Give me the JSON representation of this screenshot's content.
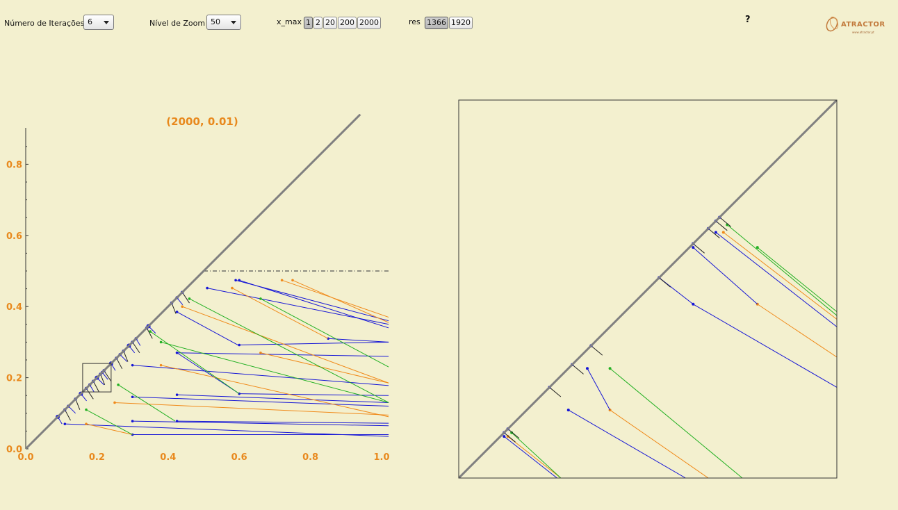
{
  "controls": {
    "iterations_label": "Número de Iterações",
    "iterations_value": "6",
    "zoom_label": "Nível de Zoom",
    "zoom_value": "50",
    "xmax_label": "x_max",
    "xmax_options": [
      "1",
      "2",
      "20",
      "200",
      "2000"
    ],
    "xmax_selected": "1",
    "res_label": "res",
    "res_options": [
      "1366",
      "1920"
    ],
    "res_selected": "1366",
    "help": "?"
  },
  "logo": {
    "name": "ATRACTOR",
    "url_text": "www.atractor.pt"
  },
  "colors": {
    "background": "#f3f0cf",
    "axis_text": "#e8891d",
    "diagonal": "#808080",
    "blue": "#1515d6",
    "orange": "#f08a1a",
    "green": "#22b022"
  },
  "chart_data": [
    {
      "type": "line",
      "title": "(2000, 0.01)",
      "x_ticks": [
        "0.0",
        "0.2",
        "0.4",
        "0.6",
        "0.8",
        "1.0"
      ],
      "y_ticks": [
        "0.0",
        "0.2",
        "0.4",
        "0.6",
        "0.8"
      ],
      "xlim": [
        0,
        1.02
      ],
      "ylim": [
        0,
        0.9
      ],
      "diagonal": [
        [
          0,
          0
        ],
        [
          0.94,
          0.94
        ]
      ],
      "dashed_line_y": 0.5,
      "dashed_line_x": [
        0.5,
        1.02
      ],
      "zoom_box": {
        "x": [
          0.16,
          0.24
        ],
        "y": [
          0.16,
          0.24
        ]
      },
      "diagonal_points": [
        0.09,
        0.11,
        0.12,
        0.14,
        0.155,
        0.17,
        0.18,
        0.19,
        0.2,
        0.21,
        0.215,
        0.22,
        0.24,
        0.255,
        0.265,
        0.275,
        0.29,
        0.3,
        0.31,
        0.34,
        0.345,
        0.41,
        0.425,
        0.44
      ],
      "segments": [
        {
          "c": "blue",
          "pts": [
            [
              0.11,
              0.07
            ],
            [
              1.02,
              0.035
            ]
          ]
        },
        {
          "c": "blue",
          "pts": [
            [
              0.3,
              0.04
            ],
            [
              1.02,
              0.04
            ]
          ]
        },
        {
          "c": "blue",
          "pts": [
            [
              0.3,
              0.078
            ],
            [
              1.02,
              0.065
            ]
          ]
        },
        {
          "c": "blue",
          "pts": [
            [
              0.425,
              0.078
            ],
            [
              1.02,
              0.072
            ]
          ]
        },
        {
          "c": "blue",
          "pts": [
            [
              0.3,
              0.146
            ],
            [
              1.02,
              0.12
            ]
          ]
        },
        {
          "c": "blue",
          "pts": [
            [
              0.425,
              0.152
            ],
            [
              1.02,
              0.13
            ]
          ]
        },
        {
          "c": "blue",
          "pts": [
            [
              0.6,
              0.155
            ],
            [
              1.02,
              0.15
            ]
          ]
        },
        {
          "c": "blue",
          "pts": [
            [
              0.3,
              0.235
            ],
            [
              1.02,
              0.178
            ]
          ]
        },
        {
          "c": "blue",
          "pts": [
            [
              0.425,
              0.27
            ],
            [
              1.02,
              0.26
            ]
          ]
        },
        {
          "c": "blue",
          "pts": [
            [
              0.6,
              0.292
            ],
            [
              1.02,
              0.3
            ]
          ]
        },
        {
          "c": "blue",
          "pts": [
            [
              0.85,
              0.31
            ],
            [
              1.02,
              0.3
            ]
          ]
        },
        {
          "c": "blue",
          "pts": [
            [
              0.51,
              0.452
            ],
            [
              1.02,
              0.35
            ]
          ]
        },
        {
          "c": "blue",
          "pts": [
            [
              0.59,
              0.474
            ],
            [
              1.02,
              0.36
            ]
          ]
        },
        {
          "c": "blue",
          "pts": [
            [
              0.6,
              0.474
            ],
            [
              1.02,
              0.34
            ]
          ]
        },
        {
          "c": "blue",
          "pts": [
            [
              0.425,
              0.385
            ],
            [
              0.6,
              0.29
            ]
          ]
        },
        {
          "c": "blue",
          "pts": [
            [
              0.425,
              0.27
            ],
            [
              0.6,
              0.155
            ]
          ]
        },
        {
          "c": "orange",
          "pts": [
            [
              0.72,
              0.474
            ],
            [
              1.02,
              0.37
            ]
          ]
        },
        {
          "c": "orange",
          "pts": [
            [
              0.75,
              0.474
            ],
            [
              1.02,
              0.355
            ]
          ]
        },
        {
          "c": "orange",
          "pts": [
            [
              0.58,
              0.452
            ],
            [
              0.85,
              0.31
            ]
          ]
        },
        {
          "c": "orange",
          "pts": [
            [
              0.44,
              0.4
            ],
            [
              1.02,
              0.185
            ]
          ]
        },
        {
          "c": "orange",
          "pts": [
            [
              0.38,
              0.235
            ],
            [
              1.02,
              0.09
            ]
          ]
        },
        {
          "c": "orange",
          "pts": [
            [
              0.25,
              0.13
            ],
            [
              1.02,
              0.095
            ]
          ]
        },
        {
          "c": "orange",
          "pts": [
            [
              0.17,
              0.07
            ],
            [
              0.3,
              0.04
            ]
          ]
        },
        {
          "c": "orange",
          "pts": [
            [
              0.66,
              0.27
            ],
            [
              1.02,
              0.185
            ]
          ]
        },
        {
          "c": "green",
          "pts": [
            [
              0.66,
              0.422
            ],
            [
              1.02,
              0.23
            ]
          ]
        },
        {
          "c": "green",
          "pts": [
            [
              0.46,
              0.422
            ],
            [
              1.02,
              0.13
            ]
          ]
        },
        {
          "c": "green",
          "pts": [
            [
              0.35,
              0.33
            ],
            [
              0.6,
              0.155
            ]
          ]
        },
        {
          "c": "green",
          "pts": [
            [
              0.26,
              0.18
            ],
            [
              0.42,
              0.078
            ]
          ]
        },
        {
          "c": "green",
          "pts": [
            [
              0.17,
              0.11
            ],
            [
              0.3,
              0.04
            ]
          ]
        },
        {
          "c": "green",
          "pts": [
            [
              0.38,
              0.3
            ],
            [
              1.02,
              0.13
            ]
          ]
        }
      ]
    },
    {
      "type": "line",
      "title": "",
      "description_axes": "zoomed view, no ticks",
      "xlim": [
        0,
        1
      ],
      "ylim": [
        0,
        1
      ],
      "diagonal": [
        [
          0,
          0
        ],
        [
          1,
          1
        ]
      ],
      "diagonal_points": [
        0.12,
        0.13,
        0.24,
        0.3,
        0.35,
        0.53,
        0.62,
        0.66,
        0.68,
        0.69,
        1.0
      ],
      "segments": [
        {
          "c": "blue",
          "pts": [
            [
              0.12,
              0.11
            ],
            [
              0.26,
              0.0
            ]
          ]
        },
        {
          "c": "orange",
          "pts": [
            [
              0.13,
              0.11
            ],
            [
              0.27,
              0.0
            ]
          ]
        },
        {
          "c": "green",
          "pts": [
            [
              0.14,
              0.12
            ],
            [
              0.27,
              0.0
            ]
          ]
        },
        {
          "c": "blue",
          "pts": [
            [
              0.29,
              0.18
            ],
            [
              0.6,
              0.0
            ]
          ]
        },
        {
          "c": "orange",
          "pts": [
            [
              0.4,
              0.18
            ],
            [
              0.66,
              0.0
            ]
          ]
        },
        {
          "c": "green",
          "pts": [
            [
              0.4,
              0.29
            ],
            [
              0.75,
              0.0
            ]
          ]
        },
        {
          "c": "blue",
          "pts": [
            [
              0.34,
              0.29
            ],
            [
              0.4,
              0.18
            ]
          ]
        },
        {
          "c": "blue",
          "pts": [
            [
              0.62,
              0.46
            ],
            [
              1.0,
              0.24
            ]
          ]
        },
        {
          "c": "orange",
          "pts": [
            [
              0.79,
              0.46
            ],
            [
              1.0,
              0.32
            ]
          ]
        },
        {
          "c": "blue",
          "pts": [
            [
              0.53,
              0.53
            ],
            [
              0.62,
              0.46
            ]
          ]
        },
        {
          "c": "blue",
          "pts": [
            [
              0.68,
              0.65
            ],
            [
              1.0,
              0.4
            ]
          ]
        },
        {
          "c": "orange",
          "pts": [
            [
              0.7,
              0.65
            ],
            [
              1.0,
              0.42
            ]
          ]
        },
        {
          "c": "green",
          "pts": [
            [
              0.71,
              0.67
            ],
            [
              1.0,
              0.43
            ]
          ]
        },
        {
          "c": "blue",
          "pts": [
            [
              0.62,
              0.61
            ],
            [
              0.79,
              0.46
            ]
          ]
        },
        {
          "c": "green",
          "pts": [
            [
              0.79,
              0.61
            ],
            [
              1.0,
              0.44
            ]
          ]
        }
      ]
    }
  ]
}
